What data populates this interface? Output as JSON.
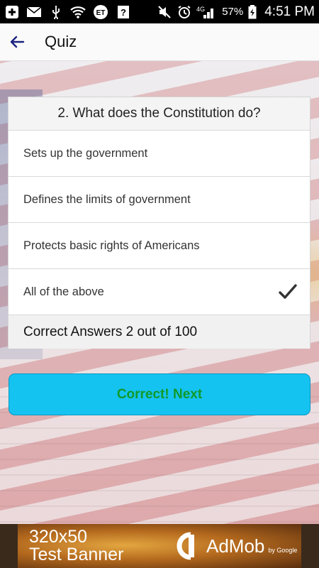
{
  "status_bar": {
    "battery_percent": "57%",
    "time": "4:51 PM",
    "network_label": "4G",
    "icons": [
      "add-icon",
      "mail-icon",
      "usb-icon",
      "wifi-icon",
      "et-icon",
      "unknown-icon",
      "mute-icon",
      "alarm-icon",
      "signal-icon",
      "battery-icon"
    ],
    "et_label": "ET",
    "unknown_label": "?"
  },
  "app_bar": {
    "title": "Quiz"
  },
  "quiz": {
    "question": "2. What does the Constitution do?",
    "options": [
      {
        "label": "Sets up the government",
        "checked": false
      },
      {
        "label": "Defines the limits of government",
        "checked": false
      },
      {
        "label": "Protects basic rights of Americans",
        "checked": false
      },
      {
        "label": "All of the above",
        "checked": true
      }
    ],
    "score_text": "Correct Answers 2 out of 100"
  },
  "next_button": {
    "label": "Correct! Next"
  },
  "ad": {
    "line1": "320x50",
    "line2": "Test Banner",
    "brand": "AdMob",
    "by": "by Google"
  },
  "colors": {
    "button_bg": "#15c3f1",
    "button_text": "#119a2a",
    "back_arrow": "#1a237e"
  }
}
